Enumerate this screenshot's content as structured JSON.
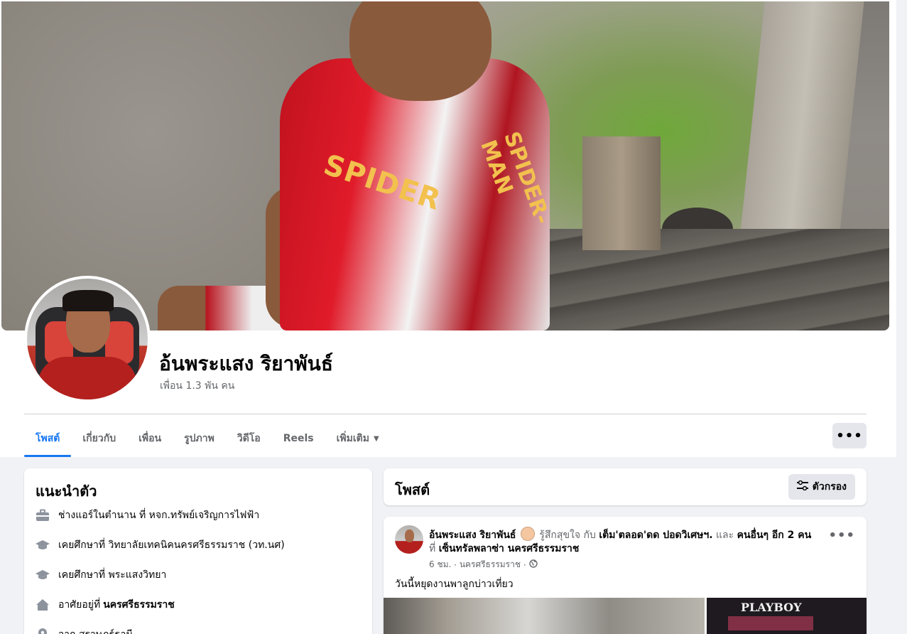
{
  "profile": {
    "name": "อ้นพระแสง ริยาพันธ์",
    "friends": "เพื่อน 1.3 พัน คน"
  },
  "tabs": [
    {
      "label": "โพสต์"
    },
    {
      "label": "เกี่ยวกับ"
    },
    {
      "label": "เพื่อน"
    },
    {
      "label": "รูปภาพ"
    },
    {
      "label": "วิดีโอ"
    },
    {
      "label": "Reels"
    },
    {
      "label": "เพิ่มเติม"
    }
  ],
  "more_button": "•••",
  "cover": {
    "emblem_text": "SPIDER",
    "emblem_text2": "SPIDER-MAN"
  },
  "intro": {
    "title": "แนะนำตัว",
    "items": [
      {
        "icon": "briefcase-icon",
        "text": "ช่างแอร์ในตำนาน ที่ หจก.ทรัพย์เจริญการไฟฟ้า",
        "bold": ""
      },
      {
        "icon": "graduation-cap-icon",
        "text": "เคยศึกษาที่ วิทยาลัยเทคนิคนครศรีธรรมราช (วท.นศ)",
        "bold": ""
      },
      {
        "icon": "graduation-cap-icon",
        "text": "เคยศึกษาที่ พระแสงวิทยา",
        "bold": ""
      },
      {
        "icon": "home-icon",
        "text": "อาศัยอยู่ที่",
        "bold": "นครศรีธรรมราช"
      },
      {
        "icon": "location-pin-icon",
        "text": "จาก สุราษฎร์ธานี",
        "bold": ""
      }
    ]
  },
  "posts_header": {
    "title": "โพสต์",
    "filter_label": "ตัวกรอง"
  },
  "post": {
    "author": "อ้นพระแสง ริยาพันธ์",
    "feeling": "รู้สึกสุขใจ กับ",
    "with_name": "เต็ม'ตลอด'ดด ปอดวิเศษฯ.",
    "and_others_prefix": "และ",
    "and_others": "คนอื่นๆ อีก 2 คน",
    "at_prefix": "ที่",
    "place": "เซ็นทรัลพลาซ่า นครศรีธรรมราช",
    "time": "6 ชม.",
    "location": "นครศรีธรรมราช",
    "sep": "·",
    "text": "วันนี้หยุดงานพาลูกบ่าวเที่ยว",
    "more": "•••",
    "image_sign": "PLAYBOY"
  },
  "colors": {
    "accent": "#1877f2",
    "muted": "#65676b",
    "background": "#f0f2f5"
  }
}
